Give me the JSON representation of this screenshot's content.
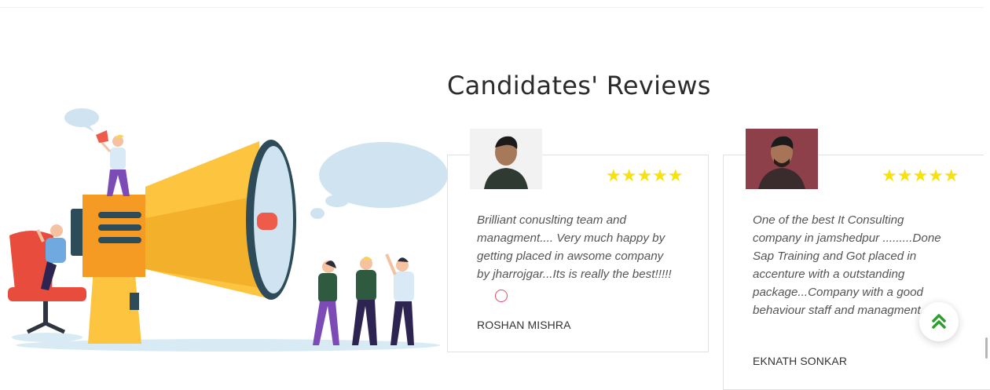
{
  "section": {
    "title": "Candidates' Reviews"
  },
  "reviews": [
    {
      "rating_stars": "★★★★★",
      "text": "Brilliant conuslting team and managment.... Very much happy by getting placed in awsome company by jharrojgar...Its is really the best!!!!!",
      "name": "ROSHAN MISHRA"
    },
    {
      "rating_stars": "★★★★★",
      "text": "One of the best It Consulting company in jamshedpur .........Done Sap Training and Got placed in accenture with a outstanding package...Company with a good behaviour staff and managment.",
      "name": "EKNATH SONKAR"
    }
  ],
  "colors": {
    "star": "#f8e20e",
    "back_to_top_arrow": "#2e9e2e",
    "megaphone": "#fcc43f"
  },
  "icons": {
    "back_to_top": "double-chevron-up-icon"
  }
}
